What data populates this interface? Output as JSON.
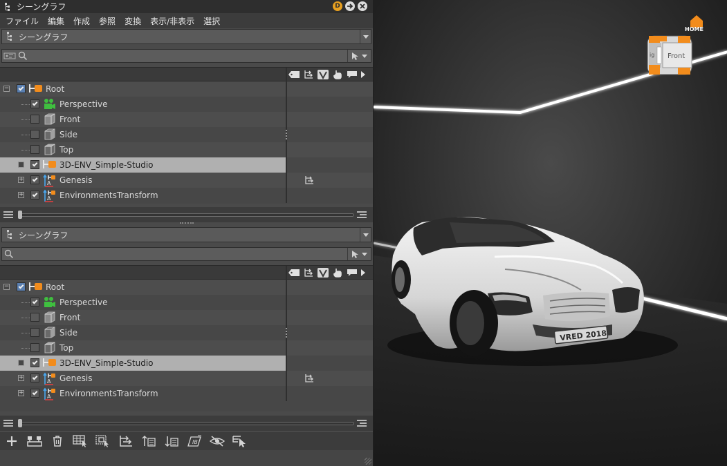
{
  "window": {
    "title": "シーングラフ",
    "badge": "D"
  },
  "menu": [
    "ファイル",
    "編集",
    "作成",
    "参照",
    "変換",
    "表示/非表示",
    "選択"
  ],
  "panels": [
    {
      "selector_label": "シーングラフ",
      "search_placeholder": "",
      "tree": [
        {
          "label": "Root",
          "checked": true,
          "icon": "group-orange-icon",
          "style": "root"
        },
        {
          "label": "Perspective",
          "checked": true,
          "icon": "perspective-camera-icon"
        },
        {
          "label": "Front",
          "checked": false,
          "icon": "front-camera-icon"
        },
        {
          "label": "Side",
          "checked": false,
          "icon": "side-camera-icon"
        },
        {
          "label": "Top",
          "checked": false,
          "icon": "top-camera-icon"
        },
        {
          "label": "3D-ENV_Simple-Studio",
          "checked": true,
          "icon": "group-orange-icon",
          "selected": true
        },
        {
          "label": "Genesis",
          "checked": true,
          "icon": "transform-icon"
        },
        {
          "label": "EnvironmentsTransform",
          "checked": true,
          "icon": "transform-icon"
        }
      ]
    },
    {
      "selector_label": "シーングラフ",
      "search_placeholder": "",
      "tree": [
        {
          "label": "Root",
          "checked": true,
          "icon": "group-orange-icon",
          "style": "root"
        },
        {
          "label": "Perspective",
          "checked": true,
          "icon": "perspective-camera-icon"
        },
        {
          "label": "Front",
          "checked": false,
          "icon": "front-camera-icon"
        },
        {
          "label": "Side",
          "checked": false,
          "icon": "side-camera-icon"
        },
        {
          "label": "Top",
          "checked": false,
          "icon": "top-camera-icon"
        },
        {
          "label": "3D-ENV_Simple-Studio",
          "checked": true,
          "icon": "group-orange-icon",
          "selected": true
        },
        {
          "label": "Genesis",
          "checked": true,
          "icon": "transform-icon"
        },
        {
          "label": "EnvironmentsTransform",
          "checked": true,
          "icon": "transform-icon"
        }
      ]
    }
  ],
  "column_icons": [
    "tag-icon",
    "transform-column-icon",
    "visibility-v-icon",
    "touch-icon",
    "comment-icon",
    "more-arrow-icon"
  ],
  "bottom_toolbar": [
    "add-icon",
    "group-icon",
    "delete-icon",
    "select-grid-icon",
    "select-box-icon",
    "transform-tool-icon",
    "move-up-icon",
    "move-down-icon",
    "rename-icon",
    "hide-icon",
    "select-cursor-icon"
  ],
  "viewport": {
    "home_label": "HOME",
    "cube_face_label": "Front",
    "cube_side_label": "ig",
    "license_plate": "VRED 2018",
    "colors": {
      "cube_accent": "#f28c1c",
      "home_accent": "#f28c1c"
    }
  }
}
